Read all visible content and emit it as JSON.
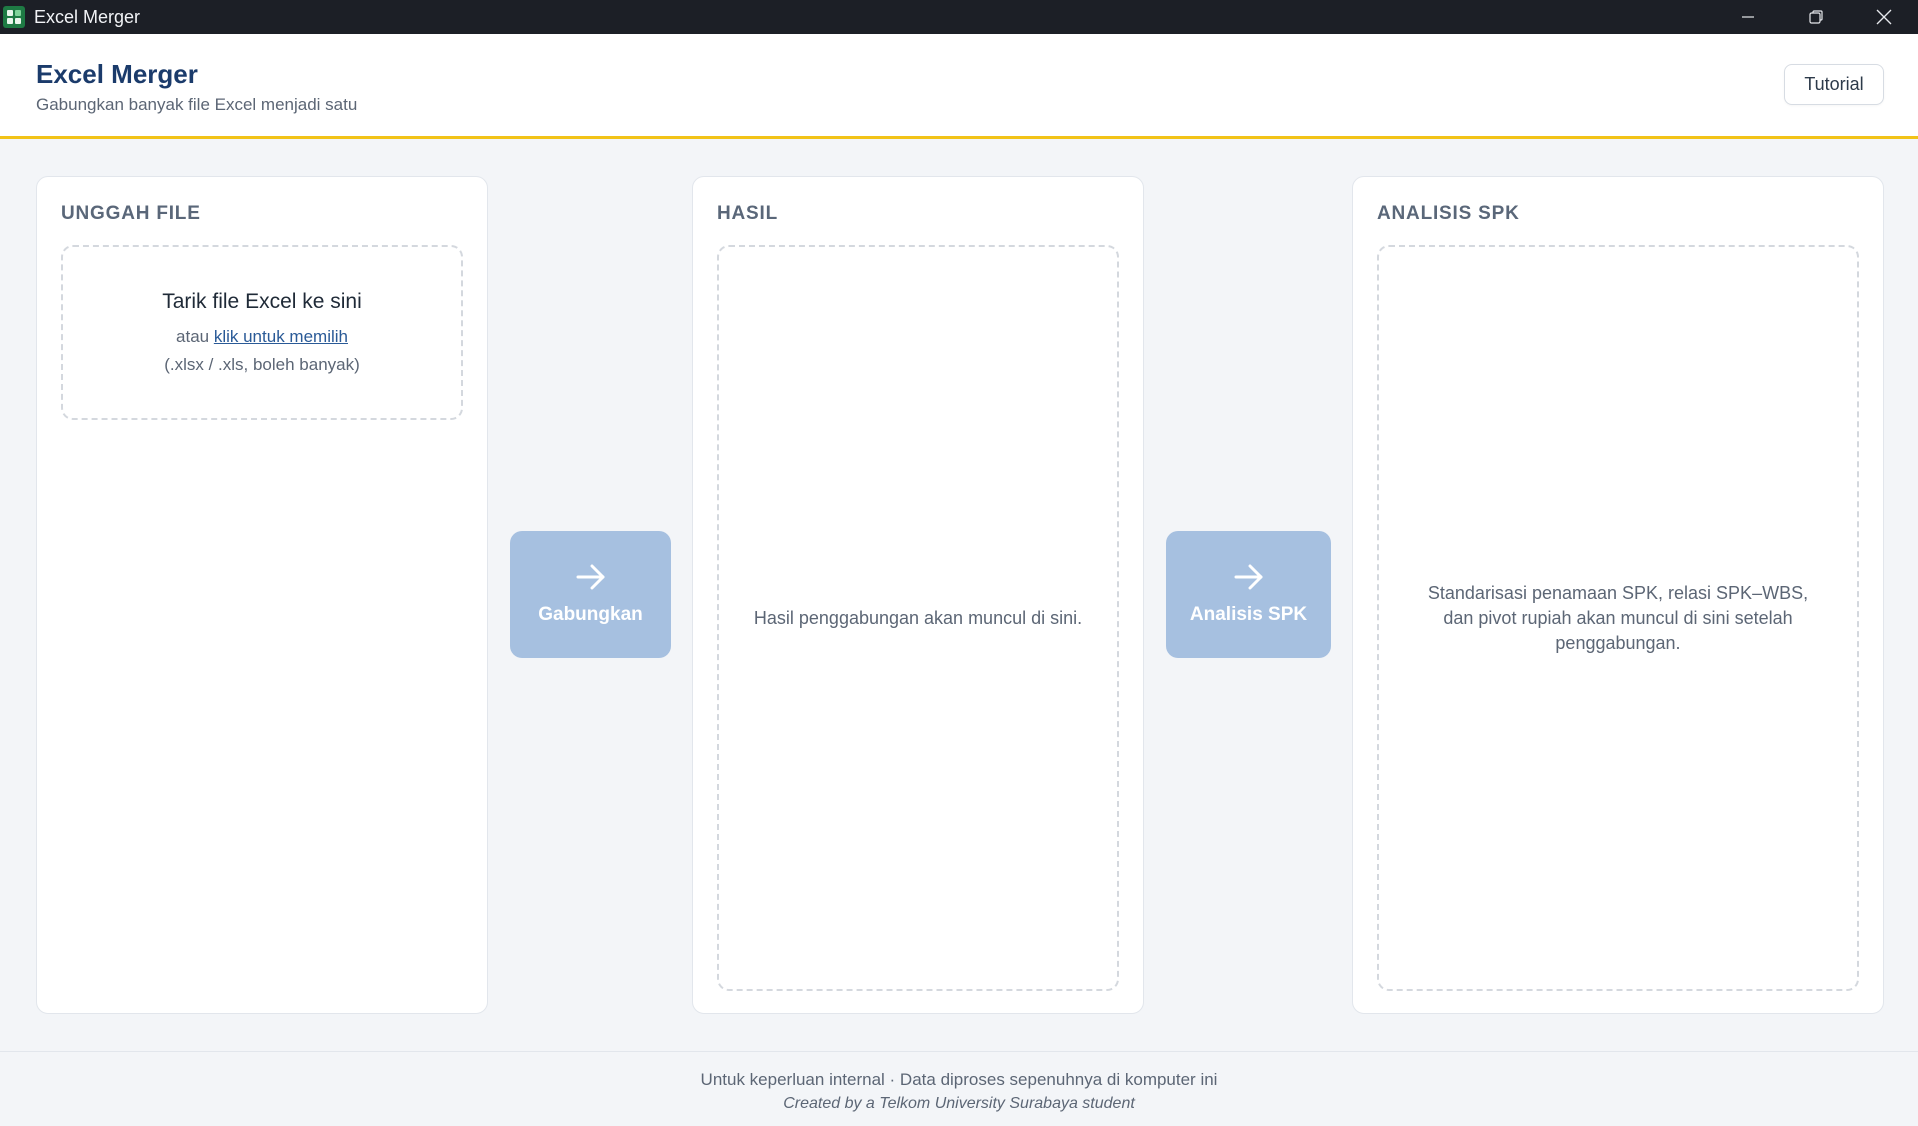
{
  "window": {
    "title": "Excel Merger",
    "icons": {
      "app": "excel-app-icon",
      "minimize": "minimize-icon",
      "maximize": "restore-icon",
      "close": "close-icon"
    }
  },
  "header": {
    "title": "Excel Merger",
    "subtitle": "Gabungkan banyak file Excel menjadi satu",
    "tutorial_label": "Tutorial"
  },
  "upload": {
    "heading": "UNGGAH FILE",
    "drop_title": "Tarik file Excel ke sini",
    "drop_or": "atau ",
    "drop_link": "klik untuk memilih",
    "drop_hint": "(.xlsx / .xls, boleh banyak)"
  },
  "merge_button": {
    "label": "Gabungkan",
    "icon": "arrow-right-icon"
  },
  "result": {
    "heading": "HASIL",
    "placeholder": "Hasil penggabungan akan muncul di sini."
  },
  "spk_button": {
    "label": "Analisis SPK",
    "icon": "arrow-right-icon"
  },
  "spk": {
    "heading": "ANALISIS SPK",
    "placeholder": "Standarisasi penamaan SPK, relasi SPK–WBS, dan pivot rupiah akan muncul di sini setelah penggabungan."
  },
  "footer": {
    "line1": "Untuk keperluan internal · Data diproses sepenuhnya di komputer ini",
    "line2": "Created by a Telkom University Surabaya student"
  },
  "colors": {
    "titlebar": "#1c1f26",
    "brand_title": "#1b3b6b",
    "accent_border": "#f2c318",
    "action_button": "#a6c0e0",
    "link": "#2a5a97"
  }
}
